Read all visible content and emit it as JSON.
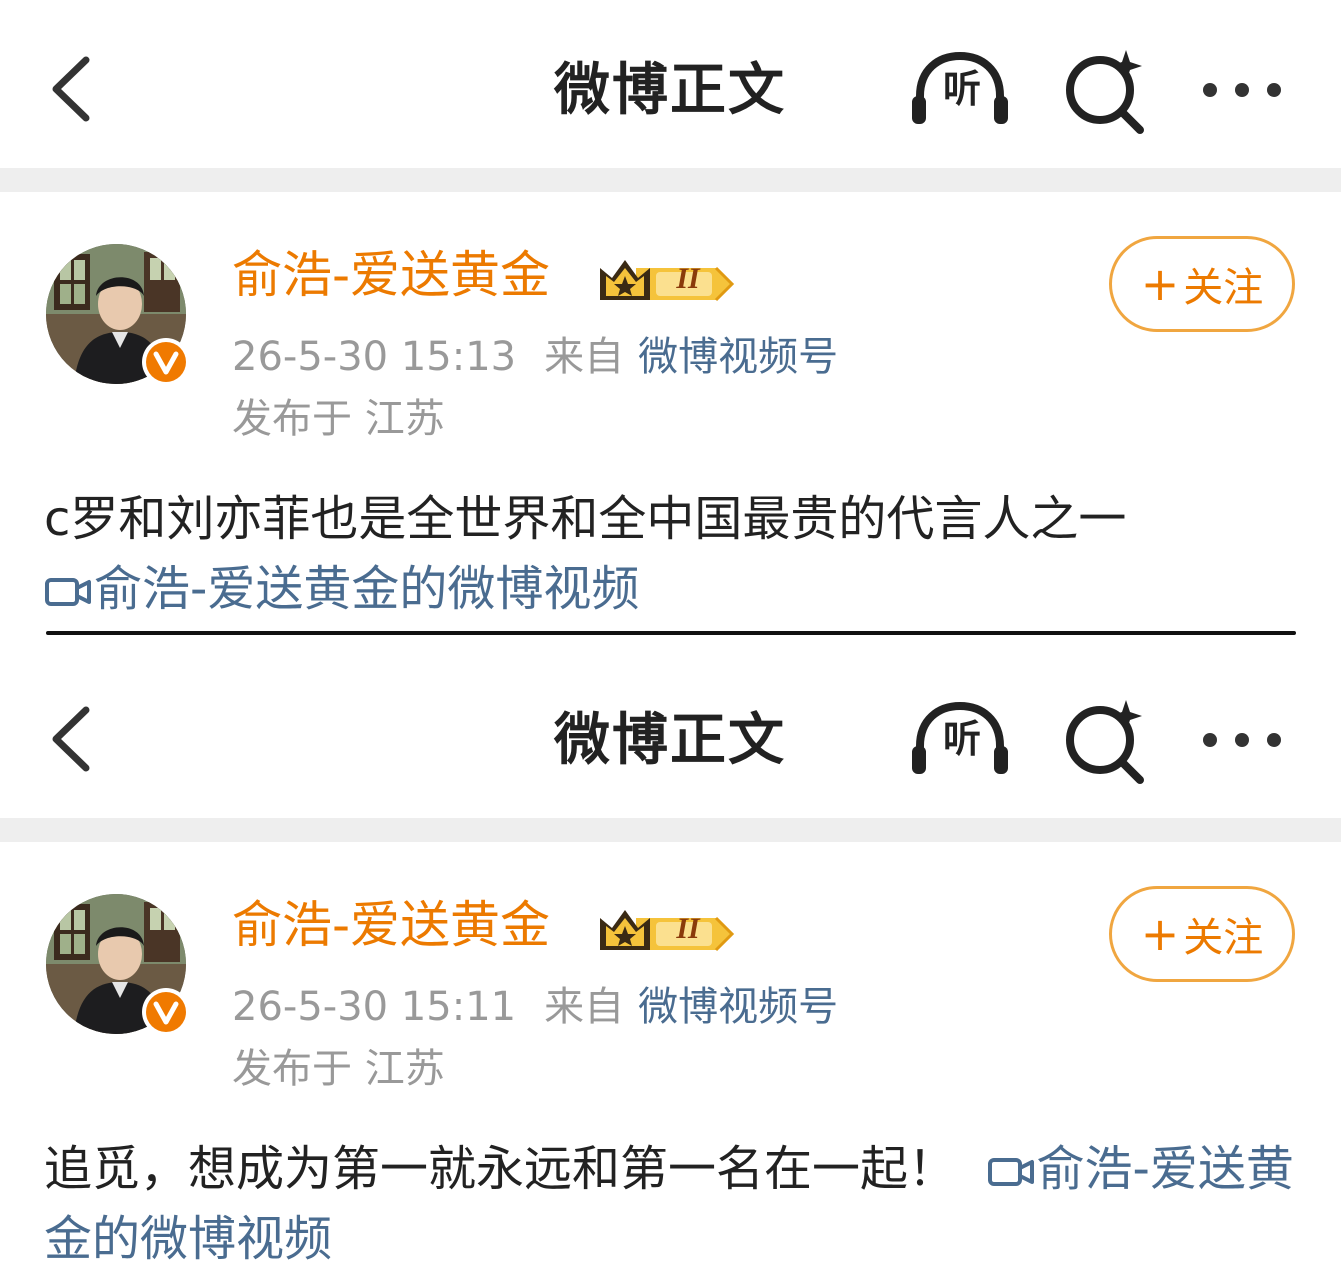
{
  "posts": [
    {
      "nav": {
        "title": "微博正文",
        "listen_label": "听"
      },
      "author": {
        "name": "俞浩-爱送黄金",
        "vip_level": "II"
      },
      "follow_label": "关注",
      "meta": {
        "time": "26-5-30 15:13",
        "source_prefix": "来自",
        "source": "微博视频号",
        "location": "发布于 江苏"
      },
      "text": "c罗和刘亦菲也是全世界和全中国最贵的代言人之一",
      "video_link": "俞浩-爱送黄金的微博视频"
    },
    {
      "nav": {
        "title": "微博正文",
        "listen_label": "听"
      },
      "author": {
        "name": "俞浩-爱送黄金",
        "vip_level": "II"
      },
      "follow_label": "关注",
      "meta": {
        "time": "26-5-30 15:11",
        "source_prefix": "来自",
        "source": "微博视频号",
        "location": "发布于 江苏"
      },
      "text": "追觅，想成为第一就永远和第一名在一起！",
      "video_link": "俞浩-爱送黄金的微博视频"
    }
  ],
  "colors": {
    "accent": "#ec7a00",
    "link": "#4a6c90",
    "meta": "#999999",
    "divider": "#eeeeee",
    "verified": "#f07a00"
  },
  "icons": [
    "back-arrow-icon",
    "listen-headphone-icon",
    "search-sparkle-icon",
    "more-icon",
    "verified-v-icon",
    "crown-icon",
    "video-icon"
  ]
}
